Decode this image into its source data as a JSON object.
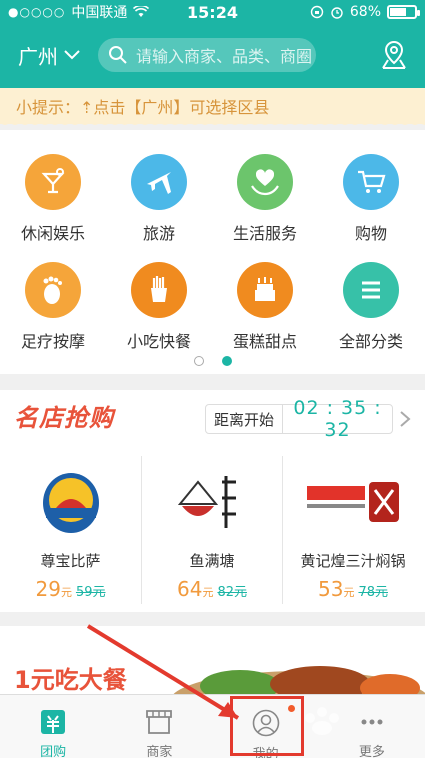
{
  "status_bar": {
    "carrier": "中国联通",
    "time": "15:24",
    "battery": "68%",
    "battery_level": 0.68
  },
  "nav": {
    "city": "广州",
    "search_placeholder": "请输入商家、品类、商圈",
    "location_icon": "map-pin-icon"
  },
  "tip": {
    "text": "小提示：⇡点击【广州】可选择区县"
  },
  "categories": [
    {
      "label": "休闲娱乐",
      "icon": "cocktail-icon",
      "color": "#f5a53a"
    },
    {
      "label": "旅游",
      "icon": "airplane-icon",
      "color": "#4cb8e8"
    },
    {
      "label": "生活服务",
      "icon": "heart-hand-icon",
      "color": "#6cc56c"
    },
    {
      "label": "购物",
      "icon": "cart-icon",
      "color": "#4cb8e8"
    },
    {
      "label": "足疗按摩",
      "icon": "foot-icon",
      "color": "#f5a53a"
    },
    {
      "label": "小吃快餐",
      "icon": "fries-icon",
      "color": "#f08b1f"
    },
    {
      "label": "蛋糕甜点",
      "icon": "cake-icon",
      "color": "#f08b1f"
    },
    {
      "label": "全部分类",
      "icon": "menu-icon",
      "color": "#37c1a8"
    }
  ],
  "pager": {
    "pages": 2,
    "active": 1
  },
  "flash": {
    "title": "名店抢购",
    "countdown_label": "距离开始",
    "countdown_time": "02 : 35 : 32",
    "shops": [
      {
        "name": "尊宝比萨",
        "price": "29",
        "unit": "元",
        "old": "59元"
      },
      {
        "name": "鱼满塘",
        "price": "64",
        "unit": "元",
        "old": "82元"
      },
      {
        "name": "黄记煌三汁焖锅",
        "price": "53",
        "unit": "元",
        "old": "78元"
      }
    ]
  },
  "banner": {
    "text": "1元吃大餐"
  },
  "tabs": [
    {
      "label": "团购",
      "icon": "tuangou-icon"
    },
    {
      "label": "商家",
      "icon": "store-icon"
    },
    {
      "label": "我的",
      "icon": "user-icon"
    },
    {
      "label": "更多",
      "icon": "more-icon"
    }
  ],
  "active_tab": 0,
  "colors": {
    "brand": "#1cb5a5",
    "accent": "#e8533a",
    "annotation": "#e33a2e"
  }
}
